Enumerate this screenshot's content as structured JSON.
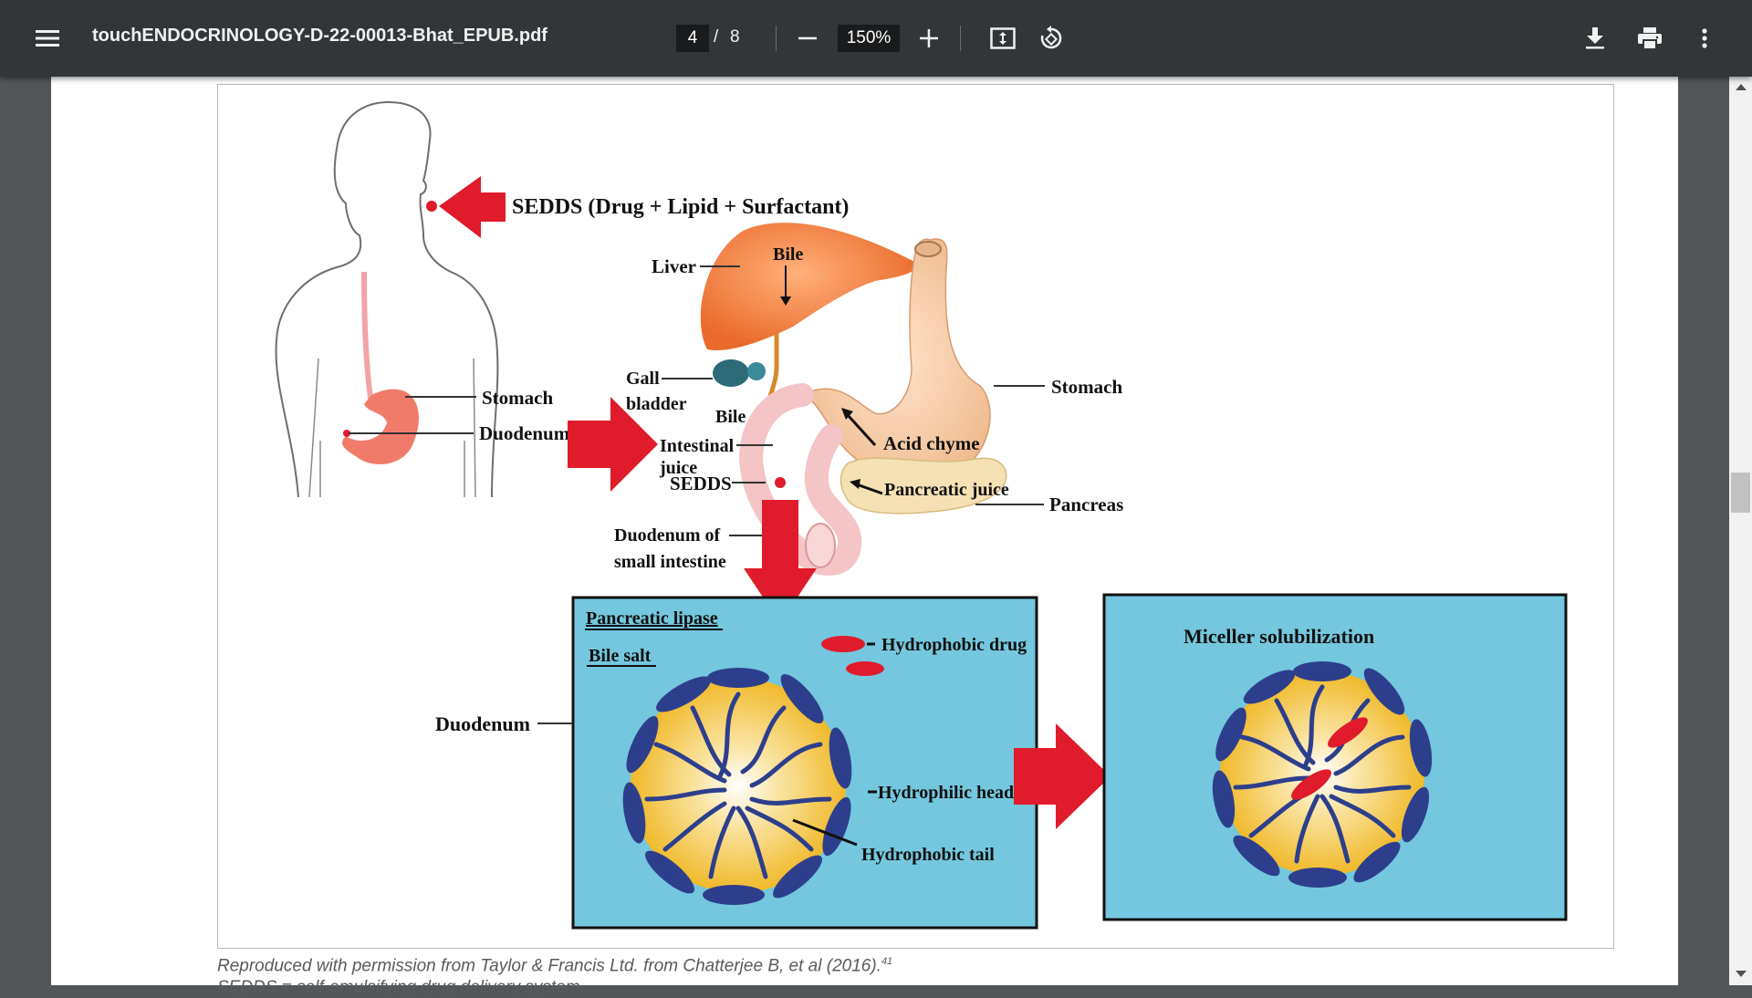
{
  "toolbar": {
    "file_name": "touchENDOCRINOLOGY-D-22-00013-Bhat_EPUB.pdf",
    "current_page": "4",
    "page_separator": "/",
    "total_pages": "8",
    "zoom": "150%"
  },
  "figure": {
    "sedds_label": "SEDDS (Drug + Lipid + Surfactant)",
    "bile_top": "Bile",
    "liver": "Liver",
    "gall_line1": "Gall",
    "gall_line2": "bladder",
    "bile_mid": "Bile",
    "stomach_left": "Stomach",
    "duodenum_left": "Duodenum",
    "intestinal_line1": "Intestinal",
    "intestinal_line2": "juice",
    "sedds_small": "SEDDS",
    "acid_chyme": "Acid chyme",
    "pancreatic_juice": "Pancreatic juice",
    "stomach_right": "Stomach",
    "pancreas": "Pancreas",
    "duodenum_small_line1": "Duodenum of",
    "duodenum_small_line2": "small intestine",
    "pancreatic_lipase": "Pancreatic lipase",
    "bile_salt": "Bile salt",
    "hydrophobic_drug": "Hydrophobic drug",
    "duodenum_bottom": "Duodenum",
    "hydrophilic_head": "Hydrophilic head",
    "hydrophobic_tail": "Hydrophobic tail",
    "miceller": "Miceller solubilization"
  },
  "caption": {
    "text": "Reproduced with permission from Taylor & Francis Ltd. from Chatterjee B, et al (2016).",
    "ref": "41",
    "text2": "SEDDS = self-emulsifying drug delivery system."
  },
  "colors": {
    "toolbar_bg": "#323639",
    "viewer_bg": "#525659",
    "arrow_red": "#e01b2b",
    "panel_blue": "#74c7de",
    "micelle_yellow": "#f3c54a",
    "micelle_blue": "#2d3f8c"
  },
  "icons": [
    "menu-icon",
    "minus-icon",
    "plus-icon",
    "fit-page-icon",
    "rotate-icon",
    "download-icon",
    "print-icon",
    "more-vert-icon"
  ]
}
